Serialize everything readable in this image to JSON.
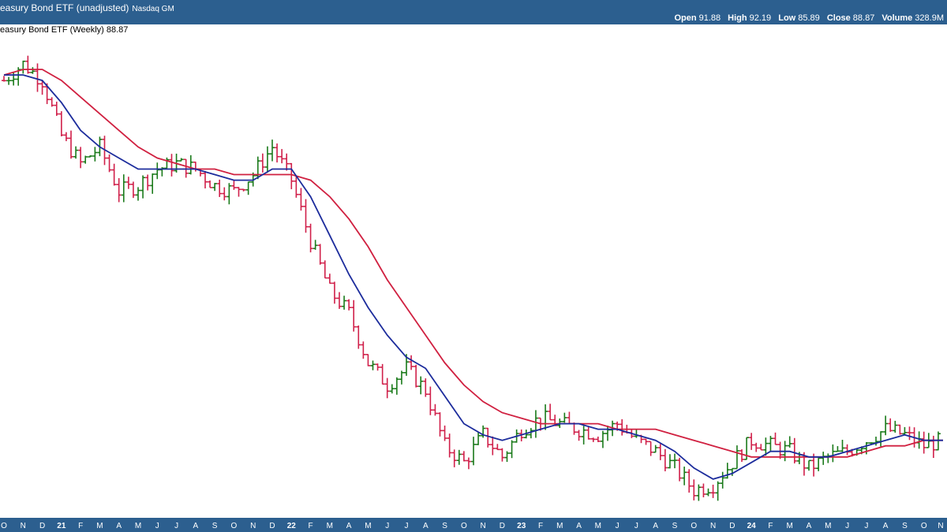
{
  "header": {
    "title": "easury Bond ETF (unadjusted)",
    "exchange": "Nasdaq GM",
    "open_label": "Open",
    "open": "91.88",
    "high_label": "High",
    "high": "92.19",
    "low_label": "Low",
    "low": "85.89",
    "close_label": "Close",
    "close": "88.87",
    "volume_label": "Volume",
    "volume": "328.9M"
  },
  "legend_text": "easury Bond ETF (Weekly) 88.87",
  "colors": {
    "header_bg": "#2c5f8f",
    "up_bar": "#1a7a1a",
    "down_bar": "#d0204a",
    "ma_short": "#1c2c9c",
    "ma_long": "#d02040"
  },
  "chart_data": {
    "type": "line",
    "title": "easury Bond ETF (Weekly) 88.87",
    "x_tick_labels": [
      "O",
      "N",
      "D",
      "21",
      "F",
      "M",
      "A",
      "M",
      "J",
      "J",
      "A",
      "S",
      "O",
      "N",
      "D",
      "22",
      "F",
      "M",
      "A",
      "M",
      "J",
      "J",
      "A",
      "S",
      "O",
      "N",
      "D",
      "23",
      "F",
      "M",
      "A",
      "M",
      "J",
      "J",
      "A",
      "S",
      "O",
      "N",
      "D",
      "24",
      "F",
      "M",
      "A",
      "M",
      "J",
      "J",
      "A",
      "S",
      "O",
      "N"
    ],
    "x_tick_indices": [
      0,
      1,
      2,
      3,
      4,
      5,
      6,
      7,
      8,
      9,
      10,
      11,
      12,
      13,
      14,
      15,
      16,
      17,
      18,
      19,
      20,
      21,
      22,
      23,
      24,
      25,
      26,
      27,
      28,
      29,
      30,
      31,
      32,
      33,
      34,
      35,
      36,
      37,
      38,
      39,
      40,
      41,
      42,
      43,
      44,
      45,
      46,
      47,
      48,
      49
    ],
    "months_start": "2020-10",
    "y_range_note": "no y-axis labels visible",
    "series": [
      {
        "kind": "ohlc",
        "close_by_month": [
          150,
          153,
          150,
          140,
          135,
          138,
          130,
          131,
          134,
          135,
          134,
          131,
          130,
          133,
          138,
          132,
          121,
          112,
          108,
          99,
          95,
          98,
          94,
          84,
          81,
          86,
          82,
          87,
          89,
          88,
          87,
          86,
          88,
          85,
          83,
          80,
          76,
          77,
          81,
          85,
          84,
          83,
          80,
          82,
          83,
          85,
          87,
          86,
          84,
          85
        ]
      },
      {
        "kind": "ma_short",
        "values": [
          151,
          151,
          150,
          146,
          141,
          138,
          136,
          134,
          134,
          134,
          134,
          133,
          132,
          132,
          134,
          134,
          129,
          122,
          115,
          109,
          104,
          100,
          98,
          93,
          88,
          86,
          85,
          86,
          87,
          88,
          88,
          87,
          87,
          86,
          85,
          83,
          80,
          78,
          79,
          81,
          83,
          83,
          82,
          82,
          83,
          84,
          85,
          86,
          85,
          85
        ]
      },
      {
        "kind": "ma_long",
        "values": [
          151,
          152,
          152,
          150,
          147,
          144,
          141,
          138,
          136,
          135,
          134,
          134,
          133,
          133,
          133,
          133,
          132,
          129,
          125,
          120,
          114,
          109,
          104,
          99,
          95,
          92,
          90,
          89,
          88,
          88,
          88,
          88,
          87,
          87,
          87,
          86,
          85,
          84,
          83,
          82,
          82,
          82,
          82,
          82,
          82,
          83,
          84,
          84,
          85,
          85
        ]
      }
    ]
  }
}
